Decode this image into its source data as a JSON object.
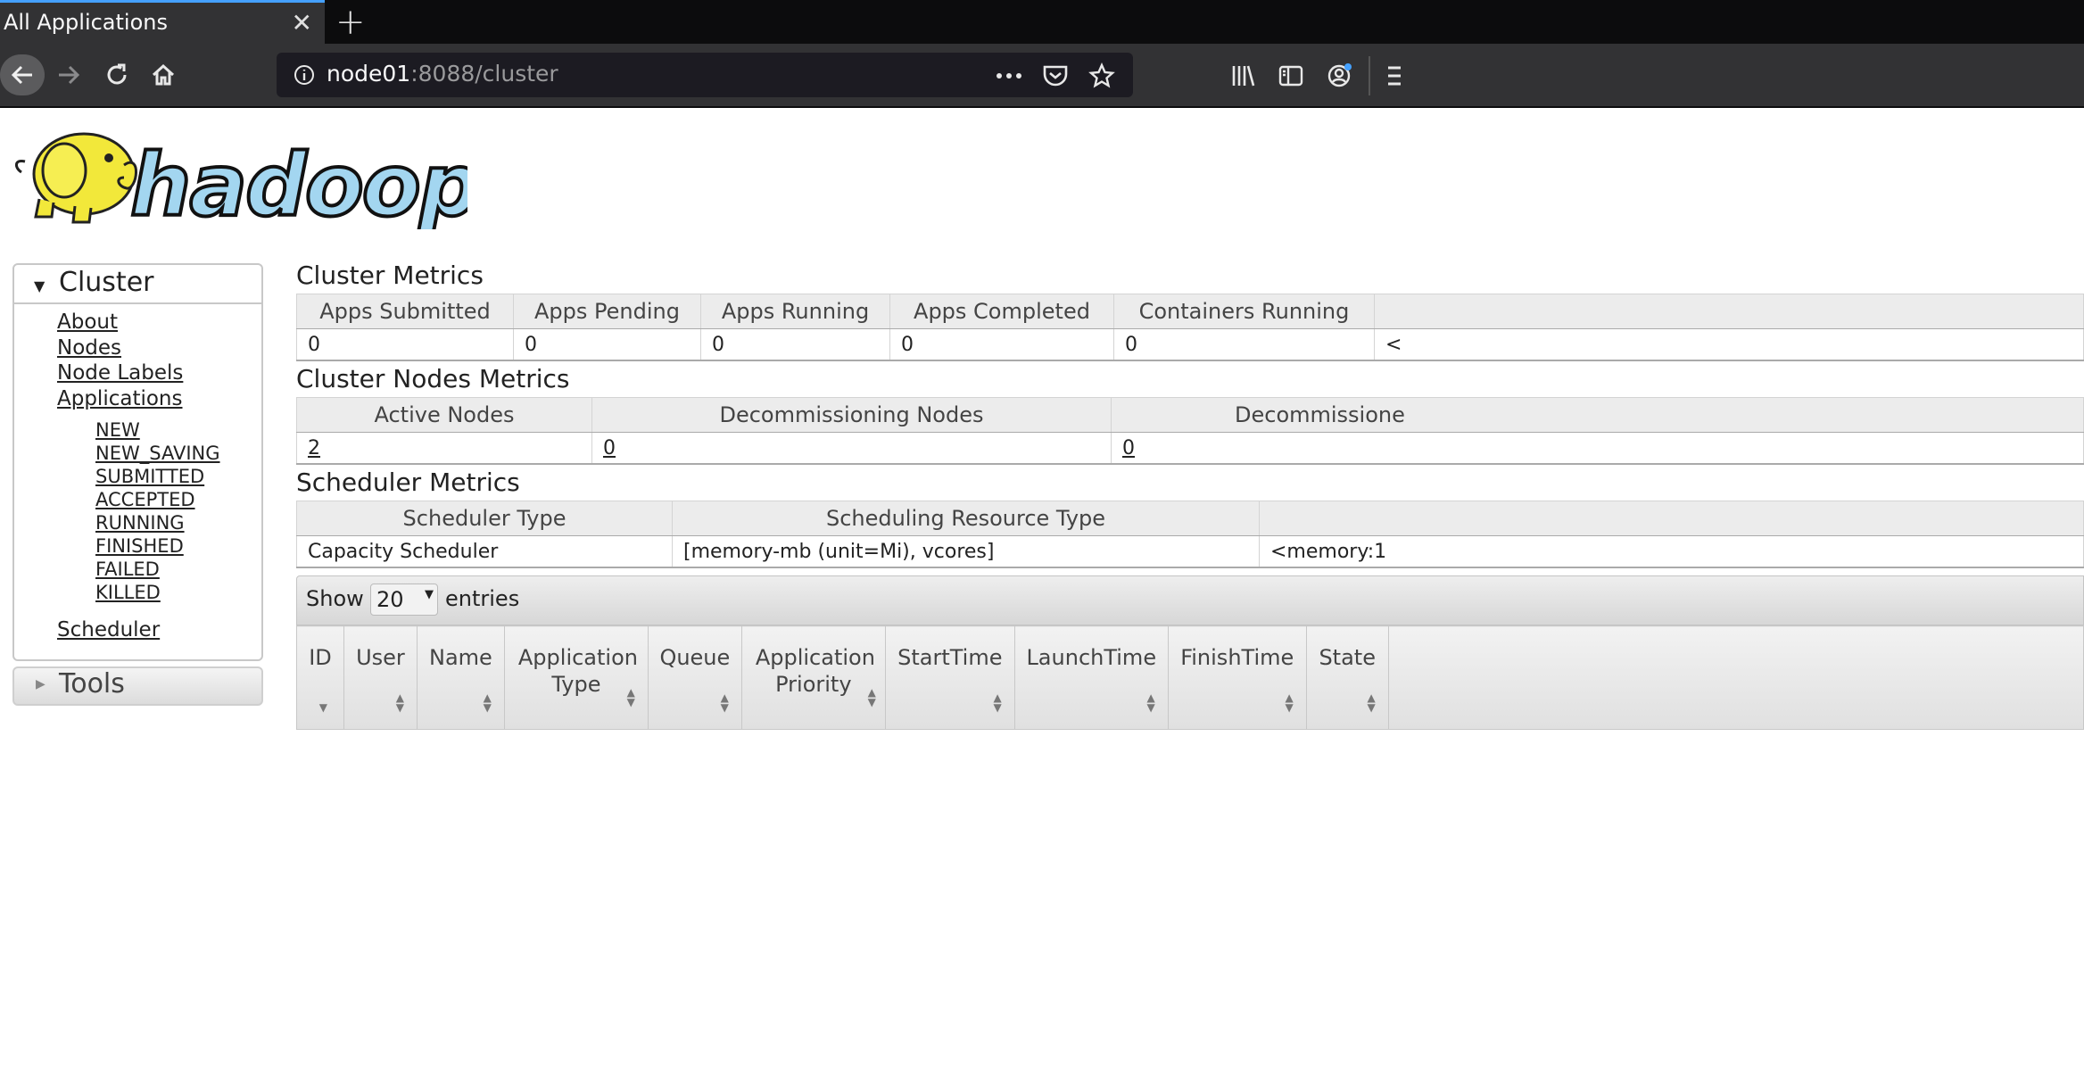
{
  "browser": {
    "tab_title": "All Applications",
    "url_host": "node01",
    "url_path": ":8088/cluster"
  },
  "sidebar": {
    "cluster_title": "Cluster",
    "links": [
      "About",
      "Nodes",
      "Node Labels",
      "Applications"
    ],
    "app_states": [
      "NEW",
      "NEW_SAVING",
      "SUBMITTED",
      "ACCEPTED",
      "RUNNING",
      "FINISHED",
      "FAILED",
      "KILLED"
    ],
    "scheduler": "Scheduler",
    "tools_title": "Tools"
  },
  "cluster_metrics": {
    "title": "Cluster Metrics",
    "headers": [
      "Apps Submitted",
      "Apps Pending",
      "Apps Running",
      "Apps Completed",
      "Containers Running",
      ""
    ],
    "values": [
      "0",
      "0",
      "0",
      "0",
      "0",
      "<"
    ]
  },
  "node_metrics": {
    "title": "Cluster Nodes Metrics",
    "headers": [
      "Active Nodes",
      "Decommissioning Nodes",
      "Decommissione"
    ],
    "values": [
      "2",
      "0",
      "0"
    ]
  },
  "scheduler_metrics": {
    "title": "Scheduler Metrics",
    "headers": [
      "Scheduler Type",
      "Scheduling Resource Type",
      ""
    ],
    "values": [
      "Capacity Scheduler",
      "[memory-mb (unit=Mi), vcores]",
      "<memory:1"
    ]
  },
  "entries": {
    "show_label": "Show",
    "page_size": "20",
    "entries_label": "entries"
  },
  "apps_table": {
    "headers": [
      "ID",
      "User",
      "Name",
      "Application Type",
      "Queue",
      "Application Priority",
      "StartTime",
      "LaunchTime",
      "FinishTime",
      "State"
    ]
  }
}
